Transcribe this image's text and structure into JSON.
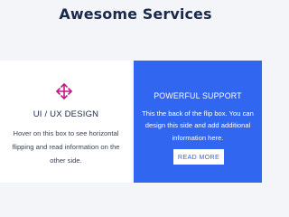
{
  "header": {
    "title": "Awesome Services"
  },
  "flip_box_front": {
    "icon": "arrows-move-icon",
    "icon_color": "#c2178a",
    "title": "UI / UX DESIGN",
    "description": "Hover on this box to see horizontal flipping and read information on the other side."
  },
  "flip_box_back": {
    "title": "POWERFUL SUPPORT",
    "description": "This the back of the flip box. You can design this side and add additional information here.",
    "button_label": "READ MORE",
    "background_color": "#3166f0"
  }
}
